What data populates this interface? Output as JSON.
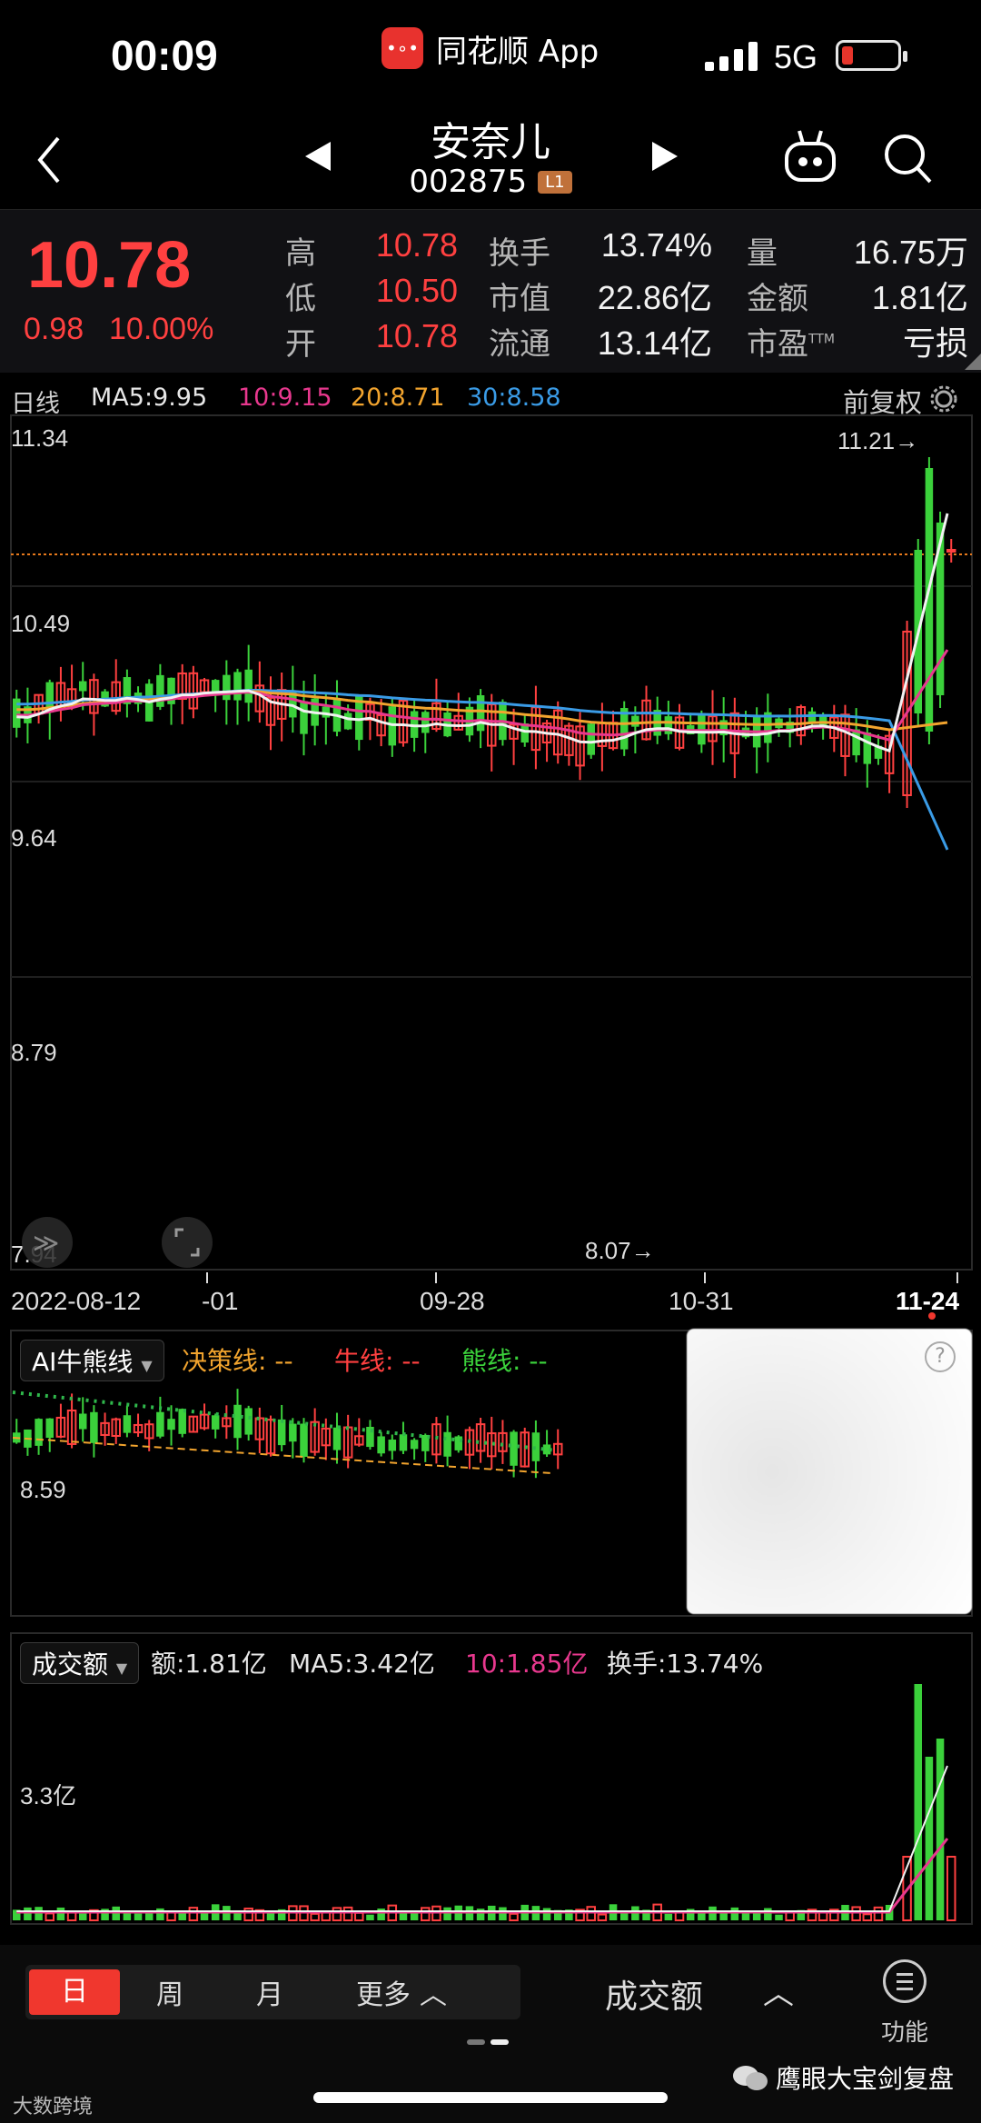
{
  "status": {
    "time": "00:09",
    "app_name": "同花顺 App",
    "network": "5G",
    "app_icon_text": "•∘•"
  },
  "nav": {
    "name": "安奈儿",
    "code": "002875",
    "level_badge": "L1"
  },
  "quote": {
    "price": "10.78",
    "change": "0.98",
    "change_pct": "10.00%",
    "rows": [
      {
        "l1": "高",
        "v1": "10.78",
        "l2": "换手",
        "v2": "13.74%",
        "l3": "量",
        "v3": "16.75万"
      },
      {
        "l1": "低",
        "v1": "10.50",
        "l2": "市值",
        "v2": "22.86亿",
        "l3": "金额",
        "v3": "1.81亿"
      },
      {
        "l1": "开",
        "v1": "10.78",
        "l2": "流通",
        "v2": "13.14亿",
        "l3": "市盈",
        "l3sup": "TTM",
        "v3": "亏损"
      }
    ]
  },
  "legend": {
    "period": "日线",
    "ma5": "MA5:9.95",
    "ma10": "10:9.15",
    "ma20": "20:8.71",
    "ma30": "30:8.58",
    "adjust": "前复权"
  },
  "axis": {
    "y_top": "11.34",
    "y_2": "10.49",
    "y_3": "9.64",
    "y_4": "8.79",
    "y_5": "7.94",
    "high_mark": "11.21→",
    "low_mark": "8.07→"
  },
  "dates": {
    "d1": "2022-08-12",
    "d2": "-01",
    "d3": "09-28",
    "d4": "10-31",
    "d5": "11-24"
  },
  "panel2": {
    "title": "AI牛熊线",
    "decision": "决策线: --",
    "bull": "牛线: --",
    "bear": "熊线: --",
    "y_label": "8.59",
    "help": "?"
  },
  "panel3": {
    "title": "成交额",
    "amount": "额:1.81亿",
    "ma5": "MA5:3.42亿",
    "ma10": "10:1.85亿",
    "turnover": "换手:13.74%",
    "y_label": "3.3亿"
  },
  "bottom": {
    "periods": [
      "日",
      "周",
      "月",
      "更多"
    ],
    "indicator": "成交额",
    "function": "功能",
    "watermark": "鹰眼大宝剑复盘",
    "corner_brand": "大数跨境"
  },
  "colors": {
    "up": "#ff4040",
    "down": "#3bd13b",
    "ma5": "#f2f2f2",
    "ma10": "#e8388e",
    "ma20": "#f2a42e",
    "ma30": "#3a9be6"
  }
}
